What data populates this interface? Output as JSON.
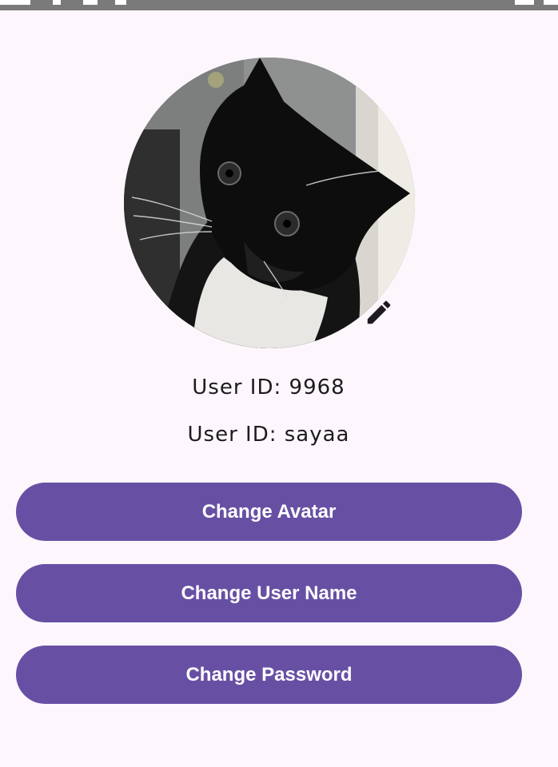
{
  "profile": {
    "avatar_alt": "cat-avatar",
    "edit_icon": "pencil-icon",
    "user_id_line": "User ID: 9968",
    "user_name_line": "User ID: sayaa"
  },
  "actions": {
    "change_avatar": "Change Avatar",
    "change_user_name": "Change User Name",
    "change_password": "Change Password"
  },
  "colors": {
    "background": "#fdf7fd",
    "button": "#6750a4",
    "button_text": "#ffffff",
    "text": "#1d1b20"
  }
}
